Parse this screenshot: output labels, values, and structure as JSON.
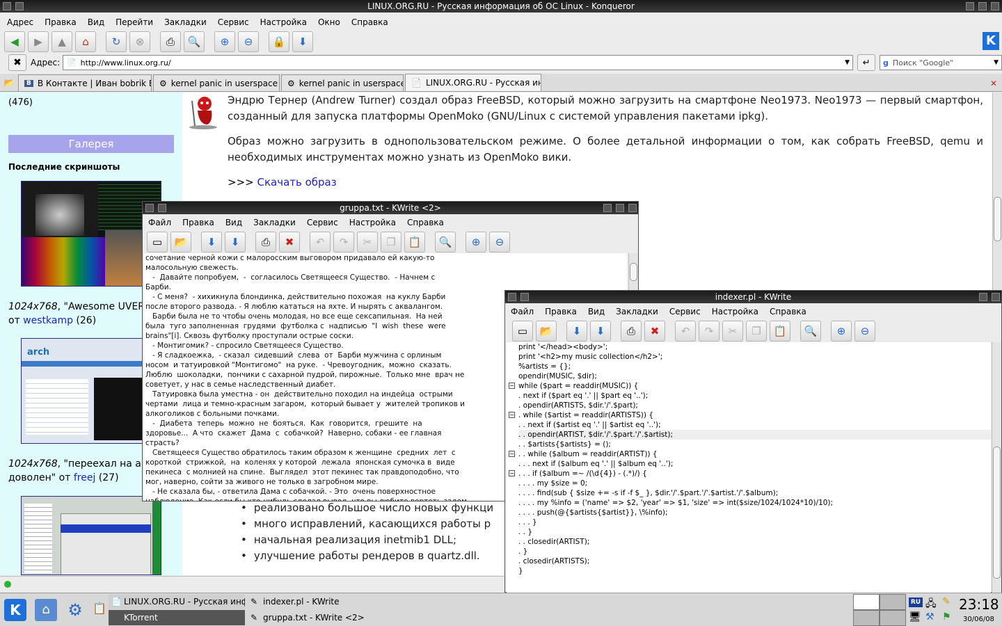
{
  "konqueror": {
    "title": "LINUX.ORG.RU - Русская информация об ОС Linux - Konqueror",
    "menu": [
      "Адрес",
      "Правка",
      "Вид",
      "Перейти",
      "Закладки",
      "Сервис",
      "Настройка",
      "Окно",
      "Справка"
    ],
    "address_label": "Адрес:",
    "url": "http://www.linux.org.ru/",
    "search_placeholder": "Поиск \"Google\"",
    "tabs": [
      {
        "label": "В Контакте | Иван bobrik Бо…"
      },
      {
        "label": "kernel panic in userspace »…"
      },
      {
        "label": "kernel panic in userspace ›…"
      },
      {
        "label": "LINUX.ORG.RU - Русская инфо…"
      }
    ]
  },
  "page": {
    "sidebar": {
      "count_top": "(476)",
      "gallery_title": "Галерея",
      "last_screens": "Последние скриншоты",
      "caption1": {
        "res": "1024x768",
        "text": ", \"Awesome UVER",
        "from": "от ",
        "user": "westkamp",
        "count": " (26)"
      },
      "caption2": {
        "res": "1024x768",
        "text": ", \"переехал на ar",
        "line2": "доволен\" от ",
        "user": "freej",
        "count": " (27)"
      }
    },
    "article": {
      "p1": "Эндрю Тернер (Andrew Turner) создал образ FreeBSD, который можно загрузить на смартфоне Neo1973. Neo1973 — первый смартфон, созданный для запуска платформы OpenMoko (GNU/Linux с системой управления пакетами ipkg).",
      "p2": "Образ можно загрузить в однопользовательском режиме. О более детальной информации о том, как собрать FreeBSD, qemu и необходимых инструментах можно узнать из OpenMoko вики.",
      "download_prefix": ">>> ",
      "download_link": "Скачать образ",
      "bullets": [
        "реализовано большое число новых функци",
        "много исправлений, касающихся работы р",
        "начальная реализация inetmib1 DLL;",
        "улучшение работы рендеров в quartz.dll."
      ]
    }
  },
  "kwrite1": {
    "title": "gruppa.txt - KWrite <2>",
    "menu": [
      "Файл",
      "Правка",
      "Вид",
      "Закладки",
      "Сервис",
      "Настройка",
      "Справка"
    ],
    "lines": [
      "сочетание черной кожи с малоросским выговором придавало ей какую-то",
      "малосольную свежесть.",
      "   -  Давайте попробуем,  -  согласилось Светящееся Существо.  - Начнем с",
      "Барби.",
      "   - С меня?  - хихикнула блондинка, действительно похожая  на куклу Барби",
      "после второго развода. - Я люблю кататься на яхте. И нырять с аквалангом.",
      "   Барби была не то чтобы очень молодая, но все еще сексапильная.  На ней",
      "была  туго заполненная  грудями  футболка с  надписью  \"I  wish  these  were",
      "brains\"[i]. Сквозь футболку проступали острые соски.",
      "   - Монтигомик? - спросило Светящееся Существо.",
      "   - Я сладкоежка,  - сказал  сидевший  слева  от  Барби мужчина с орлиным",
      "носом  и татуировкой \"Монтигомо\"  на руке.  - Чревоугодник,  можно  сказать.",
      "Люблю  шоколадки,  пончики с сахарной пудрой, пирожные.  Только мне  врач не",
      "советует, у нас в семье наследственный диабет.",
      "   Татуировка была уместна - он  действительно походил на индейца  острыми",
      "чертами  лица и темно-красным загаром,  который бывает у  жителей тропиков и",
      "алкоголиков с больными почками.",
      "   -  Диабета  теперь  можно  не  бояться.  Как  говорится,  грешите  на",
      "здоровье...  А что  скажет  Дама  с  собачкой?  Наверно, собаки - ее главная",
      "страсть?",
      "   Светящееся Существо обратилось таким образом к женщине  средних  лет  с",
      "короткой  стрижкой,  на  коленях у которой  лежала  японская сумочка в  виде",
      "пекинеса  с молнией на спине.  Выглядел  этот пекинес так правдоподобно, что",
      "мог, наверно, сойти за живого не только в загробном мире.",
      "   - Не сказала бы, - ответила Дама с собачкой. - Это  очень поверхностное",
      "наблюдение. Как если бы кто-нибудь сделал вывод, что вы любите вертеть задом"
    ]
  },
  "kwrite2": {
    "title": "indexer.pl - KWrite",
    "menu": [
      "Файл",
      "Правка",
      "Вид",
      "Закладки",
      "Сервис",
      "Настройка",
      "Справка"
    ],
    "code": [
      "print '</head><body>';",
      "print '<h2>my music collection</h2>';",
      "",
      "%artists = {};",
      "",
      "opendir(MUSIC, $dir);",
      "while ($part = readdir(MUSIC)) {",
      ". next if ($part eq '.' || $part eq '..');",
      ". opendir(ARTISTS, $dir.'/'.$part);",
      ". while ($artist = readdir(ARTISTS)) {",
      ". . next if ($artist eq '.' || $artist eq '..');",
      ". . opendir(ARTIST, $dir.'/'.$part.'/'.$artist);",
      ". . $artists{$artists} = ();",
      ". . while ($album = readdir(ARTIST)) {",
      ". . . next if ($album eq '.' || $album eq '..');",
      ". . . if ($album =~ /(\\d{4}) - (.*)/) {",
      ". . . . my $size = 0;",
      ". . . . find(sub { $size += -s if -f $_ }, $dir.'/'.$part.'/'.$artist.'/'.$album);",
      ". . . . my %info = ('name' => $2, 'year' => $1, 'size' => int($size/1024/1024*10)/10);",
      ". . . . push(@{$artists{$artist}}, \\%info);",
      ". . . }",
      ". . }",
      ". . closedir(ARTIST);",
      ". }",
      ". closedir(ARTISTS);",
      "}"
    ]
  },
  "taskbar": {
    "tasks": [
      {
        "label": "LINUX.ORG.RU - Русская информа"
      },
      {
        "label": "indexer.pl - KWrite"
      },
      {
        "label": "KTorrent"
      },
      {
        "label": "gruppa.txt - KWrite <2>"
      }
    ],
    "clock": "23:18",
    "date": "30/06/08",
    "layout_badge": "RU"
  }
}
